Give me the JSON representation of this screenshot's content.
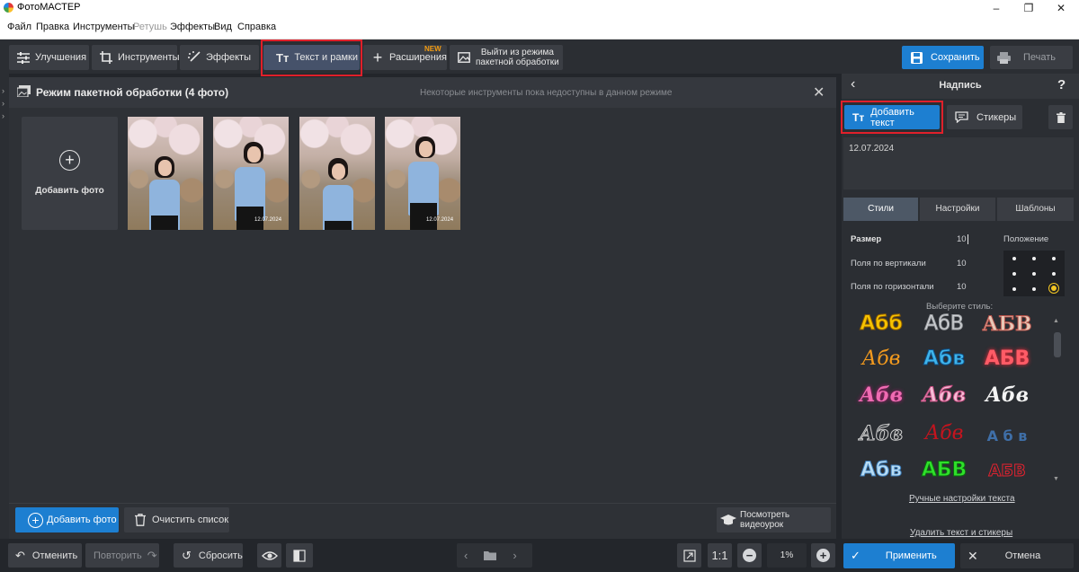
{
  "window": {
    "title": "ФотоМАСТЕР",
    "min": "–",
    "max": "❐",
    "close": "✕"
  },
  "menu": [
    {
      "label": "Файл",
      "disabled": false
    },
    {
      "label": "Правка",
      "disabled": false
    },
    {
      "label": "Инструменты",
      "disabled": false
    },
    {
      "label": "Ретушь",
      "disabled": true
    },
    {
      "label": "Эффекты",
      "disabled": false
    },
    {
      "label": "Вид",
      "disabled": false
    },
    {
      "label": "Справка",
      "disabled": false
    }
  ],
  "toolbar": {
    "improve": "Улучшения",
    "tools": "Инструменты",
    "effects": "Эффекты",
    "text_frames": "Текст и рамки",
    "extensions": "Расширения",
    "new_badge": "NEW",
    "exit_batch_line1": "Выйти из режима",
    "exit_batch_line2": "пакетной обработки",
    "save": "Сохранить",
    "print": "Печать"
  },
  "main": {
    "title": "Режим пакетной обработки (4 фото)",
    "notice": "Некоторые инструменты пока недоступны в данном режиме",
    "close": "✕",
    "add_photo_tile": "Добавить фото",
    "thumbnails": [
      {
        "date": ""
      },
      {
        "date": "12.07.2024"
      },
      {
        "date": ""
      },
      {
        "date": "12.07.2024"
      }
    ],
    "add_photo_button": "Добавить фото",
    "clear_list": "Очистить список",
    "watch_tutorial": "Посмотреть видеоурок"
  },
  "bottom": {
    "undo": "Отменить",
    "redo": "Повторить",
    "reset": "Сбросить",
    "zoom_1to1": "1:1",
    "zoom_value": "1%"
  },
  "right": {
    "title": "Надпись",
    "help": "?",
    "add_text": "Добавить текст",
    "stickers": "Стикеры",
    "text_value": "12.07.2024",
    "tabs": [
      "Стили",
      "Настройки",
      "Шаблоны"
    ],
    "size_label": "Размер",
    "size_value": "10",
    "position_label": "Положение",
    "vmargin_label": "Поля по вертикали",
    "vmargin_value": "10",
    "hmargin_label": "Поля по горизонтали",
    "hmargin_value": "10",
    "choose_style": "Выберите стиль:",
    "styles": [
      "Абб",
      "АбВ",
      "АБВ",
      "Абв",
      "Абв",
      "АБВ",
      "Абв",
      "Абв",
      "Абв",
      "Абв",
      "Абв",
      "А б в",
      "Абв",
      "АБВ",
      "АБВ"
    ],
    "manual_settings": "Ручные настройки текста",
    "delete_text": "Удалить текст и стикеры",
    "apply": "Применить",
    "cancel": "Отмена"
  },
  "colors": {
    "accent": "#1d7fd1",
    "highlight": "#e0202a",
    "badge": "#f39c12",
    "selected_position": "#f3c623"
  }
}
